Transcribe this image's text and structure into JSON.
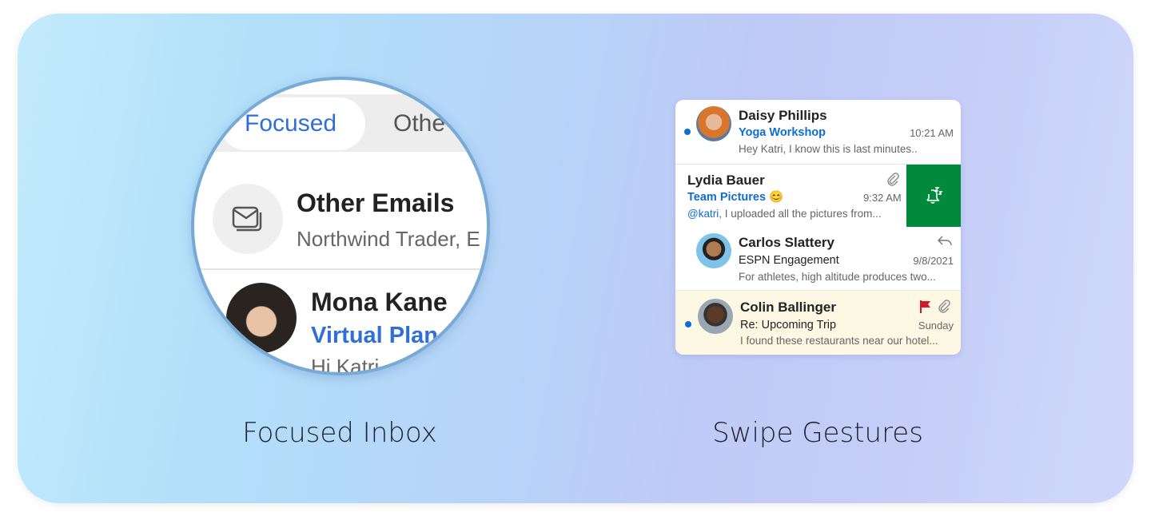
{
  "features": [
    {
      "caption": "Focused Inbox"
    },
    {
      "caption": "Swipe Gestures"
    }
  ],
  "focused_inbox": {
    "tabs": [
      {
        "label": "Focused",
        "active": true
      },
      {
        "label": "Othe"
      }
    ],
    "other_emails": {
      "title": "Other Emails",
      "senders": "Northwind Trader, E",
      "icon": "envelope-stack-icon"
    },
    "message": {
      "sender": "Mona Kane",
      "subject": "Virtual Plan",
      "preview": "Hi Katri, ..."
    },
    "accent": "#2f6fd6"
  },
  "swipe": {
    "messages": [
      {
        "sender": "Daisy Phillips",
        "subject": "Yoga Workshop",
        "time": "10:21 AM",
        "preview": "Hey Katri, I know this is last minutes..",
        "unread": true
      },
      {
        "sender": "Lydia Bauer",
        "subject": "Team Pictures",
        "emoji": "😊",
        "time": "9:32 AM",
        "mention": "@katri",
        "preview": ", I uploaded all the pictures from...",
        "attachment": true
      },
      {
        "sender": "Carlos Slattery",
        "subject": "ESPN Engagement",
        "time": "9/8/2021",
        "preview": "For athletes, high altitude produces two...",
        "replied": true
      },
      {
        "sender": "Colin Ballinger",
        "subject": "Re: Upcoming Trip",
        "time": "Sunday",
        "preview": "I found these restaurants near our hotel...",
        "unread": true,
        "flagged": true,
        "attachment": true
      }
    ],
    "swipe_action": {
      "icon": "snooze-bell-icon",
      "color": "#028a3c"
    },
    "flag_color": "#d11a2a",
    "highlight_color": "#fdf8e4"
  }
}
